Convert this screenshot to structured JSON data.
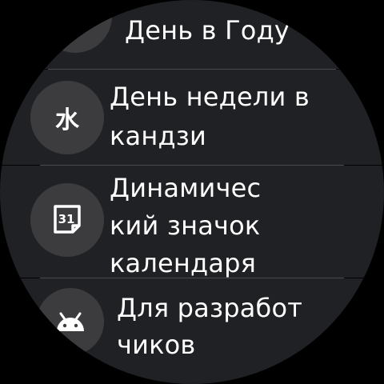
{
  "settings_list": {
    "items": [
      {
        "label_lines": [
          "День в Году"
        ],
        "icon": "calendar-day-icon"
      },
      {
        "label_lines": [
          "День недели в",
          "кандзи"
        ],
        "icon": "kanji-icon",
        "icon_glyph": "水"
      },
      {
        "label_lines": [
          "Динамичес",
          "кий значок",
          "календаря"
        ],
        "icon": "calendar-31-icon",
        "icon_text": "31"
      },
      {
        "label_lines": [
          "Для разработ",
          "чиков"
        ],
        "icon": "android-icon"
      }
    ]
  }
}
